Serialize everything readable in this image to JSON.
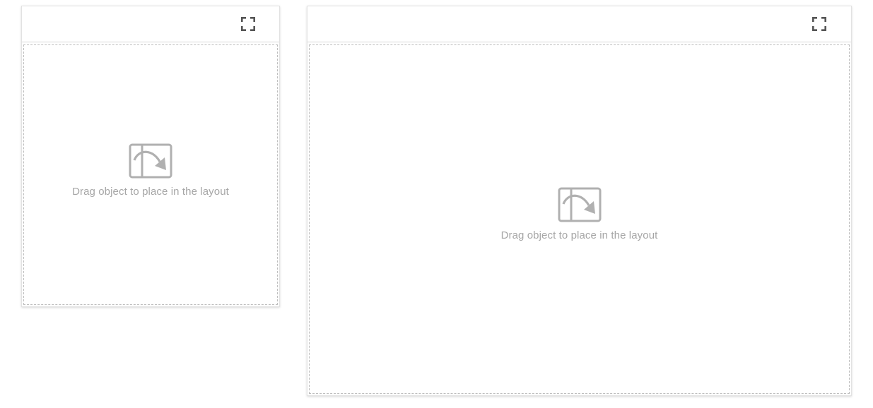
{
  "panels": [
    {
      "fullscreen_icon": "fullscreen-icon",
      "dropzone": {
        "icon": "drag-to-layout-icon",
        "text": "Drag object to place in the layout"
      }
    },
    {
      "fullscreen_icon": "fullscreen-icon",
      "dropzone": {
        "icon": "drag-to-layout-icon",
        "text": "Drag object to place in the layout"
      }
    }
  ],
  "colors": {
    "icon_dark": "#555555",
    "icon_light": "#b0b0b0",
    "placeholder_text": "#a6a6a6",
    "dashed_border": "#bdbdbd"
  }
}
